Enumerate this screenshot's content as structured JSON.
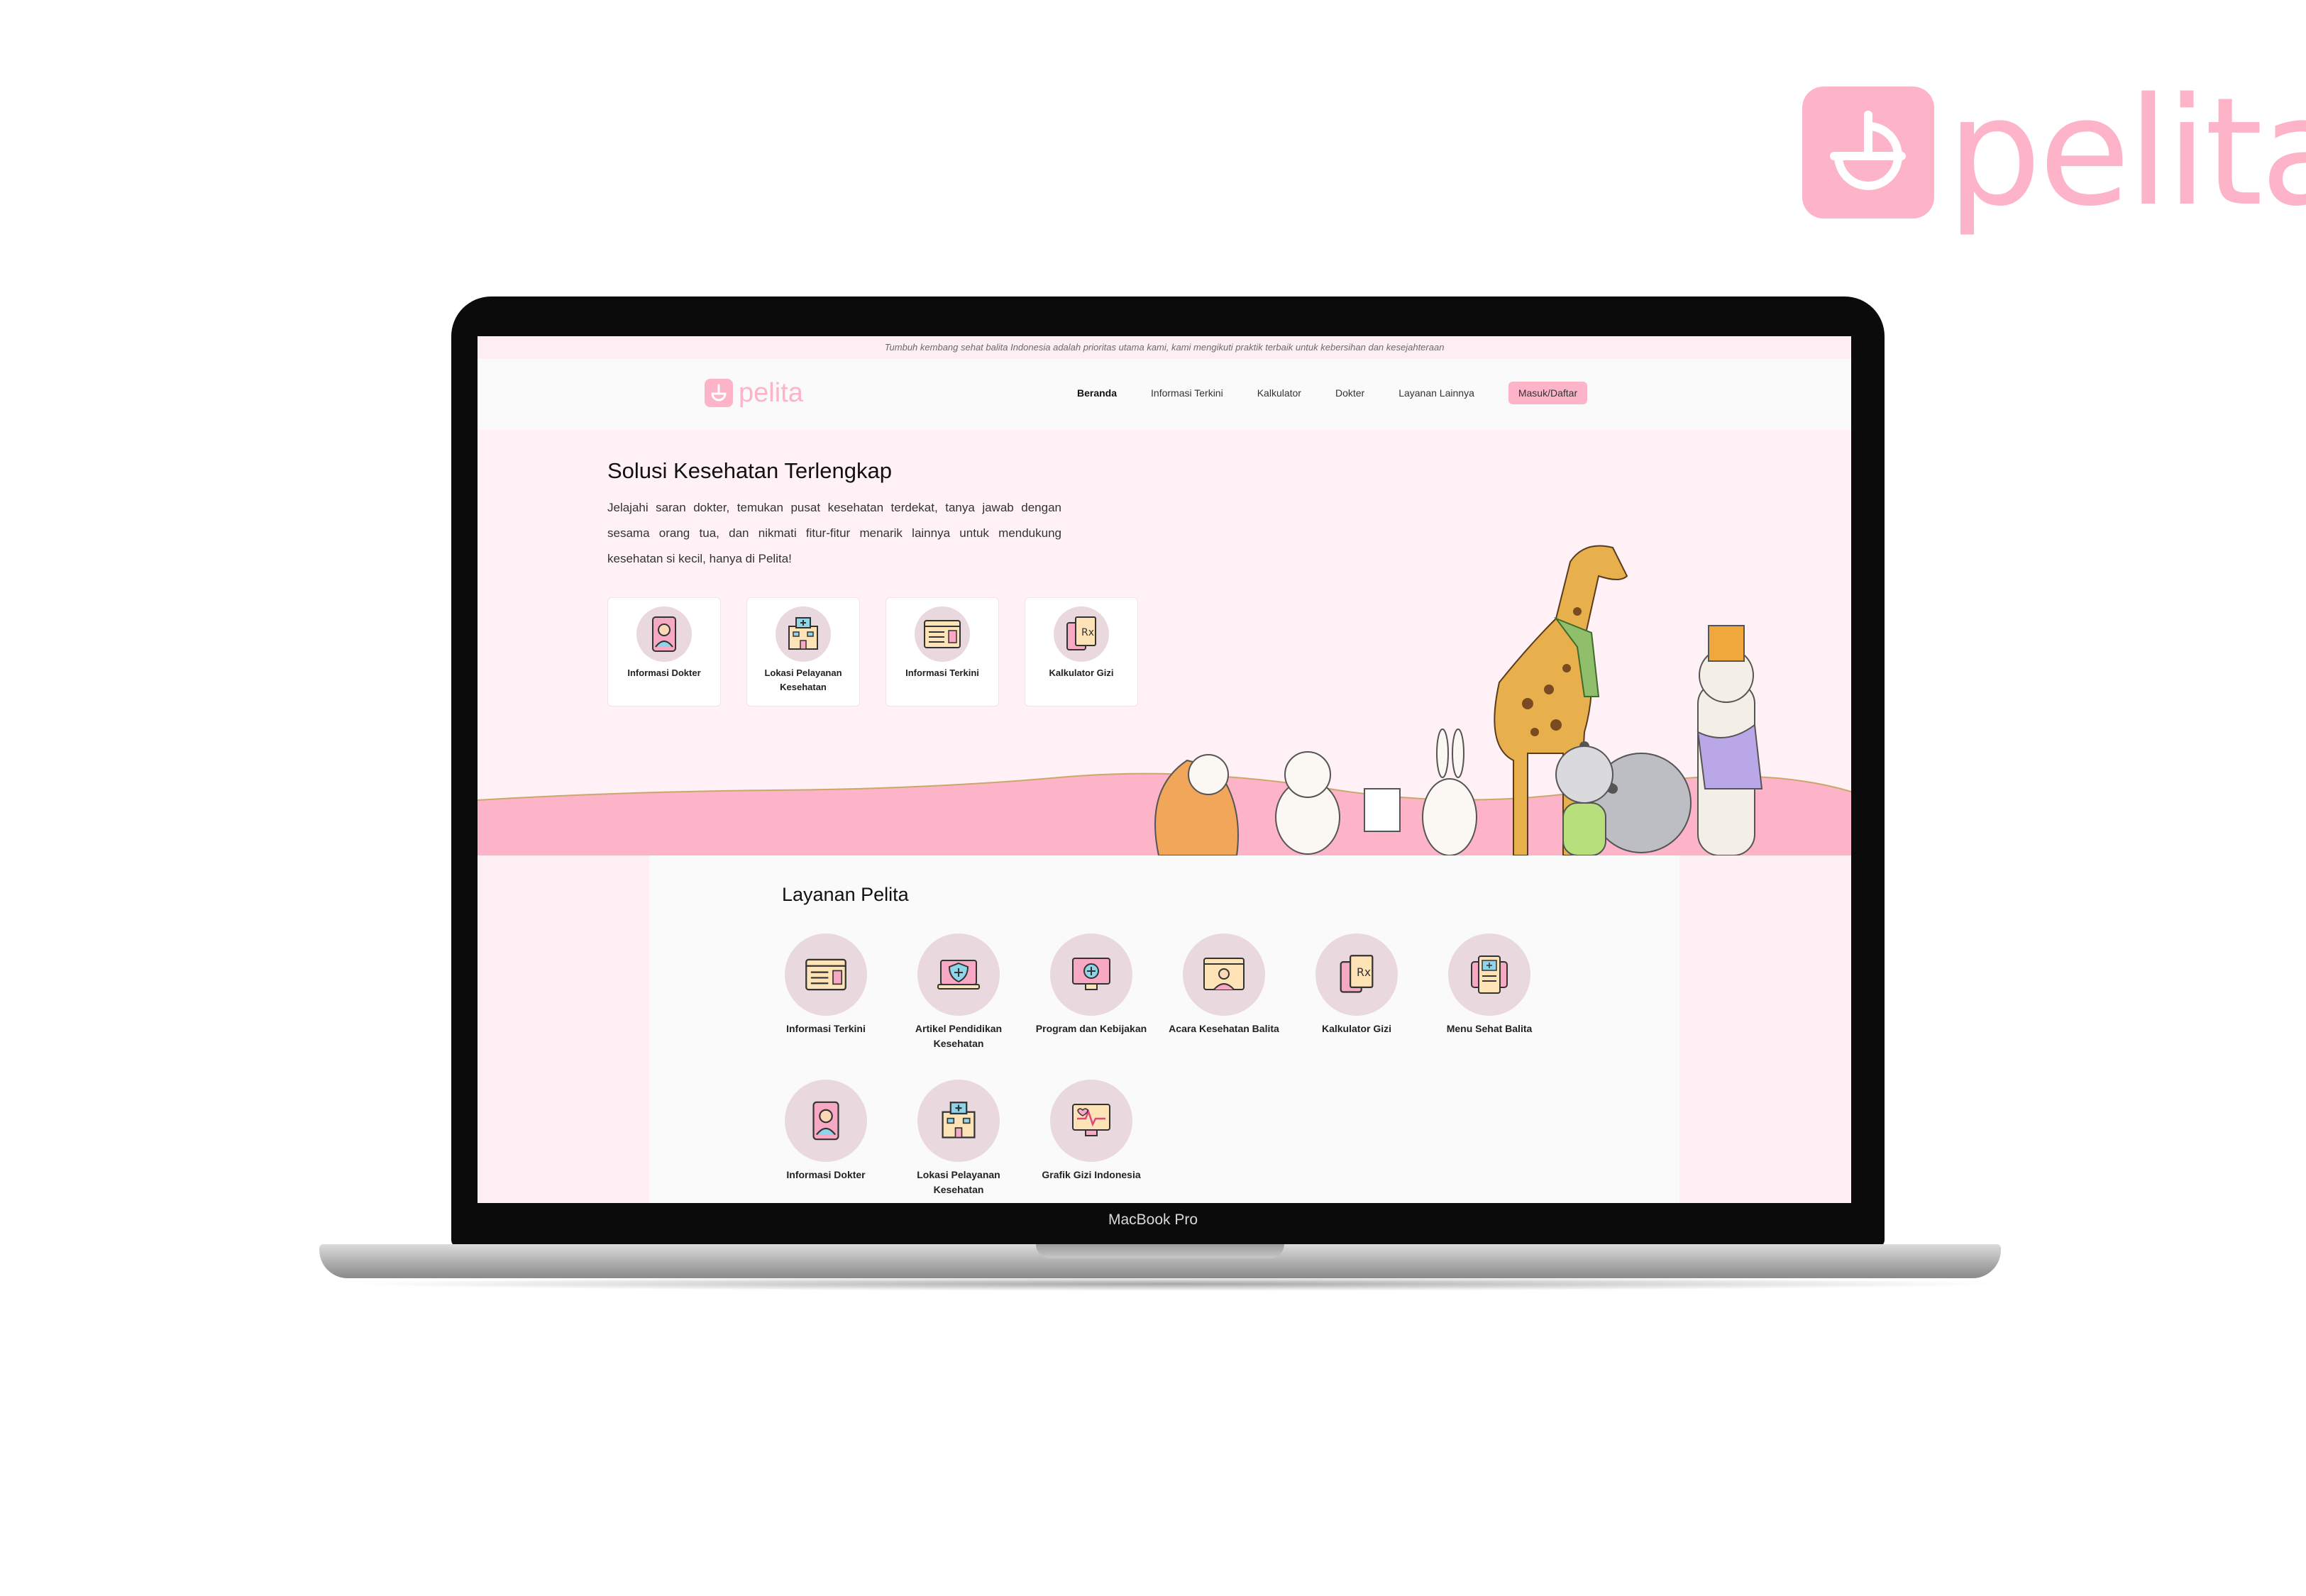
{
  "brand": {
    "name": "pelita",
    "color": "#fdb3c8"
  },
  "laptop": {
    "label": "MacBook Pro"
  },
  "page": {
    "topbar_text": "Tumbuh kembang sehat balita Indonesia adalah prioritas utama kami, kami mengikuti praktik terbaik untuk kebersihan dan kesejahteraan",
    "nav": {
      "logo": "pelita",
      "links": [
        "Beranda",
        "Informasi Terkini",
        "Kalkulator",
        "Dokter",
        "Layanan Lainnya"
      ],
      "active": "Beranda",
      "login_label": "Masuk/Daftar"
    },
    "hero": {
      "title": "Solusi Kesehatan Terlengkap",
      "description": "Jelajahi saran dokter, temukan pusat kesehatan terdekat, tanya jawab dengan sesama orang tua, dan nikmati fitur-fitur menarik lainnya untuk mendukung kesehatan si kecil, hanya di Pelita!",
      "cards": [
        {
          "label": "Informasi Dokter",
          "icon": "doctor-phone-icon"
        },
        {
          "label": "Lokasi Pelayanan Kesehatan",
          "icon": "hospital-icon"
        },
        {
          "label": "Informasi Terkini",
          "icon": "news-browser-icon"
        },
        {
          "label": "Kalkulator Gizi",
          "icon": "prescription-icon"
        }
      ]
    },
    "services": {
      "title": "Layanan Pelita",
      "items": [
        {
          "label": "Informasi Terkini",
          "icon": "news-browser-icon"
        },
        {
          "label": "Artikel Pendidikan Kesehatan",
          "icon": "health-shield-laptop-icon"
        },
        {
          "label": "Program dan Kebijakan",
          "icon": "medical-monitor-icon"
        },
        {
          "label": "Acara Kesehatan Balita",
          "icon": "video-doctor-icon"
        },
        {
          "label": "Kalkulator Gizi",
          "icon": "prescription-icon"
        },
        {
          "label": "Menu Sehat Balita",
          "icon": "medical-tablet-icon"
        },
        {
          "label": "Informasi Dokter",
          "icon": "doctor-phone-icon"
        },
        {
          "label": "Lokasi Pelayanan Kesehatan",
          "icon": "hospital-icon"
        },
        {
          "label": "Grafik Gizi Indonesia",
          "icon": "heart-chart-icon"
        }
      ]
    }
  }
}
